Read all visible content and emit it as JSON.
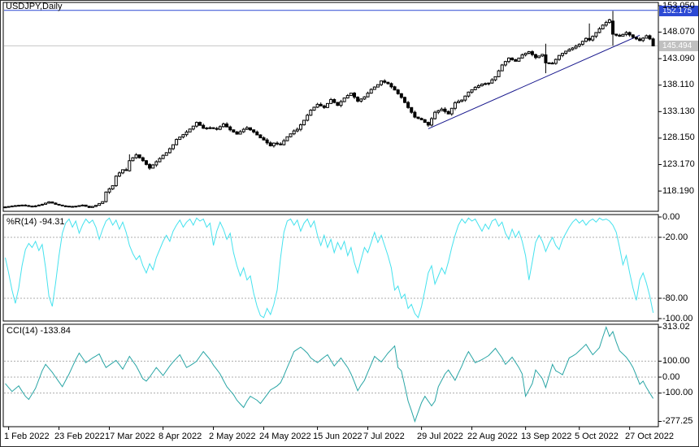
{
  "window": {
    "title": "USDJPY,Daily"
  },
  "colors": {
    "background": "#FFFFFF",
    "panel_border": "#000000",
    "ask_line": "#2C49D4",
    "ask_box_bg": "#2C49D4",
    "last_line": "#C6C6C6",
    "last_box_bg": "#C0C0C0",
    "trendline": "#16168C",
    "wpr_line": "#45E2EE",
    "cci_line": "#29A5A5",
    "grid_dash": "#ADADAD",
    "bull_body": "#FFFFFF",
    "bear_body": "#000000",
    "wick": "#000000"
  },
  "chart_data": {
    "type": "candlestick_with_indicators",
    "symbol": "USDJPY",
    "timeframe": "Daily",
    "candle_count": 194,
    "x_axis": {
      "labels": [
        {
          "label": "1 Feb 2022",
          "i": 1
        },
        {
          "label": "23 Feb 2022",
          "i": 16
        },
        {
          "label": "17 Mar 2022",
          "i": 31
        },
        {
          "label": "8 Apr 2022",
          "i": 47
        },
        {
          "label": "2 May 2022",
          "i": 62
        },
        {
          "label": "24 May 2022",
          "i": 77
        },
        {
          "label": "15 Jun 2022",
          "i": 93
        },
        {
          "label": "7 Jul 2022",
          "i": 108
        },
        {
          "label": "29 Jul 2022",
          "i": 124
        },
        {
          "label": "22 Aug 2022",
          "i": 139
        },
        {
          "label": "13 Sep 2022",
          "i": 155
        },
        {
          "label": "5 Oct 2022",
          "i": 171
        },
        {
          "label": "27 Oct 2022",
          "i": 186
        }
      ]
    },
    "panels": [
      {
        "name": "price",
        "type": "candlestick",
        "y_ticks": [
          "153.050",
          "148.070",
          "143.090",
          "138.110",
          "133.130",
          "128.150",
          "123.170",
          "118.190"
        ],
        "ask_price": "152.175",
        "ask_value": 152.175,
        "last_price": "145.494",
        "last_value": 145.494,
        "trendline": {
          "i1": 126,
          "p1": 129.9,
          "i2": 189,
          "p2": 147.5
        },
        "close_anchors": [
          [
            0,
            115.2
          ],
          [
            3,
            115.45
          ],
          [
            5,
            115.55
          ],
          [
            8,
            115.25
          ],
          [
            11,
            115.7
          ],
          [
            13,
            116.15
          ],
          [
            15,
            115.7
          ],
          [
            17,
            115.4
          ],
          [
            20,
            115.25
          ],
          [
            23,
            115.55
          ],
          [
            25,
            115.1
          ],
          [
            27,
            115.5
          ],
          [
            29,
            116.2
          ],
          [
            30,
            118.0
          ],
          [
            32,
            119.2
          ],
          [
            33,
            121.0
          ],
          [
            35,
            122.2
          ],
          [
            36,
            122.1
          ],
          [
            37,
            123.9
          ],
          [
            39,
            125.0
          ],
          [
            41,
            123.9
          ],
          [
            43,
            122.5
          ],
          [
            45,
            123.7
          ],
          [
            47,
            124.9
          ],
          [
            48,
            125.4
          ],
          [
            50,
            126.9
          ],
          [
            51,
            127.9
          ],
          [
            53,
            128.8
          ],
          [
            54,
            129.3
          ],
          [
            56,
            130.4
          ],
          [
            57,
            131.1
          ],
          [
            59,
            130.0
          ],
          [
            61,
            130.1
          ],
          [
            63,
            129.8
          ],
          [
            65,
            130.8
          ],
          [
            67,
            129.7
          ],
          [
            69,
            128.9
          ],
          [
            71,
            129.8
          ],
          [
            72,
            130.1
          ],
          [
            74,
            129.3
          ],
          [
            76,
            128.2
          ],
          [
            77,
            127.8
          ],
          [
            79,
            126.7
          ],
          [
            80,
            127.2
          ],
          [
            82,
            126.9
          ],
          [
            84,
            128.4
          ],
          [
            86,
            129.5
          ],
          [
            87,
            129.8
          ],
          [
            89,
            131.5
          ],
          [
            91,
            133.4
          ],
          [
            93,
            134.5
          ],
          [
            95,
            133.9
          ],
          [
            97,
            135.4
          ],
          [
            99,
            134.3
          ],
          [
            101,
            135.7
          ],
          [
            103,
            136.6
          ],
          [
            105,
            135.1
          ],
          [
            107,
            135.9
          ],
          [
            109,
            137.3
          ],
          [
            111,
            138.2
          ],
          [
            112,
            138.9
          ],
          [
            114,
            138.4
          ],
          [
            116,
            137.2
          ],
          [
            118,
            135.8
          ],
          [
            120,
            133.9
          ],
          [
            122,
            132.1
          ],
          [
            124,
            131.6
          ],
          [
            126,
            130.6
          ],
          [
            128,
            133.0
          ],
          [
            130,
            133.6
          ],
          [
            132,
            132.7
          ],
          [
            134,
            134.8
          ],
          [
            136,
            135.3
          ],
          [
            138,
            136.8
          ],
          [
            140,
            137.7
          ],
          [
            142,
            138.3
          ],
          [
            144,
            138.5
          ],
          [
            146,
            139.7
          ],
          [
            148,
            141.9
          ],
          [
            150,
            143.2
          ],
          [
            152,
            142.6
          ],
          [
            154,
            143.8
          ],
          [
            156,
            144.4
          ],
          [
            158,
            143.3
          ],
          [
            160,
            143.9
          ],
          [
            161,
            142.3
          ],
          [
            163,
            142.2
          ],
          [
            165,
            143.7
          ],
          [
            167,
            144.5
          ],
          [
            169,
            145.1
          ],
          [
            171,
            145.8
          ],
          [
            173,
            146.9
          ],
          [
            174,
            146.6
          ],
          [
            176,
            148.0
          ],
          [
            178,
            149.4
          ],
          [
            180,
            150.4
          ],
          [
            181,
            147.7
          ],
          [
            183,
            147.3
          ],
          [
            185,
            148.0
          ],
          [
            187,
            147.1
          ],
          [
            189,
            146.5
          ],
          [
            191,
            147.4
          ],
          [
            192,
            146.8
          ],
          [
            193,
            145.49
          ]
        ],
        "special_candles": {
          "37": {
            "o": 122.0,
            "h": 125.1,
            "l": 121.85,
            "c": 123.9
          },
          "161": {
            "o": 143.8,
            "h": 145.9,
            "l": 140.35,
            "c": 142.3
          },
          "174": {
            "o": 146.9,
            "h": 149.7,
            "l": 146.3,
            "c": 146.6
          },
          "181": {
            "o": 150.15,
            "h": 152.05,
            "l": 145.55,
            "c": 147.7
          },
          "193": {
            "o": 146.8,
            "h": 147.05,
            "l": 145.4,
            "c": 145.49
          }
        }
      },
      {
        "name": "wpr",
        "label": "%R(14) -94.31",
        "indicator": "%R",
        "period": 14,
        "current_value": -94.31,
        "type": "line",
        "ylim": [
          -100,
          0
        ],
        "levels": [
          -20,
          -80
        ],
        "y_ticks": [
          "0.00",
          "-20.00",
          "-80.00",
          "-100.00"
        ],
        "values": [
          -40,
          -55,
          -72,
          -85,
          -70,
          -48,
          -32,
          -26,
          -30,
          -24,
          -33,
          -27,
          -50,
          -78,
          -88,
          -65,
          -38,
          -16,
          -6,
          -2,
          -10,
          -4,
          -16,
          -8,
          -2,
          -6,
          -3,
          -10,
          -22,
          -12,
          -4,
          -1,
          -8,
          -3,
          -12,
          -5,
          -15,
          -28,
          -36,
          -42,
          -38,
          -48,
          -55,
          -46,
          -52,
          -40,
          -32,
          -24,
          -18,
          -24,
          -14,
          -8,
          -3,
          -10,
          -5,
          -2,
          -8,
          -1,
          -4,
          -2,
          -10,
          -6,
          -28,
          -14,
          -5,
          -12,
          -22,
          -16,
          -35,
          -48,
          -58,
          -50,
          -62,
          -58,
          -75,
          -88,
          -97,
          -99,
          -90,
          -96,
          -86,
          -72,
          -40,
          -15,
          -4,
          -2,
          -8,
          -3,
          -14,
          -6,
          -2,
          -10,
          -4,
          -18,
          -28,
          -18,
          -30,
          -22,
          -35,
          -25,
          -32,
          -24,
          -38,
          -30,
          -45,
          -55,
          -42,
          -30,
          -35,
          -25,
          -15,
          -25,
          -18,
          -28,
          -38,
          -50,
          -72,
          -68,
          -80,
          -76,
          -90,
          -86,
          -95,
          -99,
          -88,
          -72,
          -55,
          -48,
          -66,
          -58,
          -50,
          -56,
          -44,
          -30,
          -18,
          -8,
          -2,
          -6,
          -1,
          -4,
          -2,
          -8,
          -14,
          -7,
          -12,
          -4,
          -2,
          -9,
          -5,
          -16,
          -22,
          -12,
          -20,
          -14,
          -24,
          -38,
          -62,
          -44,
          -25,
          -18,
          -24,
          -34,
          -26,
          -20,
          -28,
          -32,
          -22,
          -16,
          -10,
          -5,
          -2,
          -6,
          -3,
          -8,
          -4,
          -2,
          -5,
          -1,
          -3,
          -2,
          -4,
          -8,
          -15,
          -30,
          -47,
          -38,
          -55,
          -70,
          -82,
          -62,
          -55,
          -65,
          -78,
          -94.31
        ]
      },
      {
        "name": "cci",
        "label": "CCI(14) -133.84",
        "indicator": "CCI",
        "period": 14,
        "current_value": -133.84,
        "type": "line",
        "ylim": [
          -277.25,
          313.02
        ],
        "levels": [
          100,
          0,
          -100
        ],
        "y_ticks": [
          "313.02",
          "100.00",
          "0.00",
          "-100.00",
          "-277.25"
        ],
        "values": [
          -40,
          -65,
          -90,
          -72,
          -55,
          -88,
          -120,
          -140,
          -105,
          -70,
          -15,
          40,
          80,
          55,
          30,
          0,
          -30,
          -60,
          -20,
          20,
          65,
          110,
          150,
          120,
          90,
          105,
          120,
          132,
          145,
          100,
          60,
          75,
          90,
          105,
          78,
          50,
          90,
          130,
          100,
          70,
          30,
          -10,
          -25,
          0,
          30,
          60,
          35,
          10,
          40,
          70,
          95,
          118,
          140,
          100,
          60,
          72,
          85,
          100,
          130,
          160,
          135,
          110,
          75,
          48,
          20,
          -20,
          -60,
          -85,
          -110,
          -145,
          -168,
          -190,
          -150,
          -120,
          -132,
          -145,
          -165,
          -138,
          -110,
          -80,
          -68,
          -55,
          -35,
          10,
          60,
          110,
          160,
          174,
          188,
          170,
          150,
          120,
          105,
          90,
          108,
          125,
          140,
          105,
          70,
          95,
          120,
          90,
          60,
          20,
          -30,
          -85,
          -50,
          -20,
          30,
          80,
          130,
          112,
          95,
          122,
          150,
          172,
          195,
          60,
          40,
          -55,
          -150,
          -210,
          -277.25,
          -218,
          -160,
          -120,
          -150,
          -180,
          -150,
          -60,
          -20,
          20,
          45,
          12,
          -20,
          25,
          70,
          120,
          160,
          125,
          90,
          100,
          110,
          122,
          135,
          158,
          180,
          150,
          120,
          80,
          102,
          125,
          92,
          60,
          20,
          -120,
          -80,
          -40,
          45,
          18,
          -10,
          -65,
          8,
          80,
          40,
          28,
          15,
          68,
          120,
          132,
          145,
          165,
          185,
          205,
          172,
          140,
          162,
          185,
          250,
          313.02,
          255,
          285,
          220,
          165,
          145,
          125,
          95,
          60,
          10,
          -45,
          -25,
          -65,
          -100,
          -133.84
        ]
      }
    ]
  }
}
